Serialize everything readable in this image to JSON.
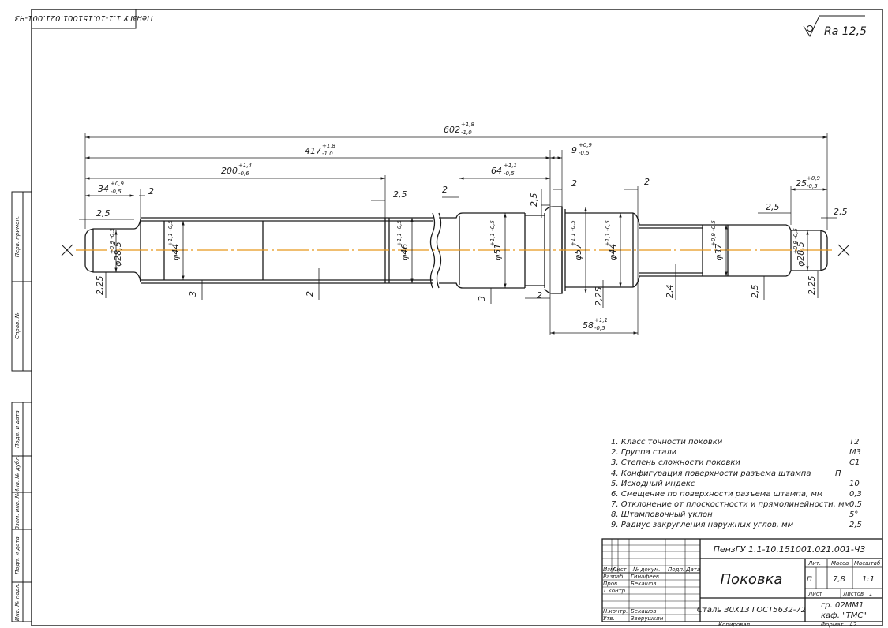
{
  "doc_code_rotated": "ПензГУ 1.1-10.151001.021.001-Ч3",
  "roughness": "Ra 12,5",
  "dimensions": {
    "overall": "602",
    "overall_tol_upper": "+1,8",
    "overall_tol_lower": "-1,0",
    "d417": "417",
    "d417_upper": "+1,8",
    "d417_lower": "-1,0",
    "d200": "200",
    "d200_upper": "+1,4",
    "d200_lower": "-0,6",
    "d34": "34",
    "d34_upper": "+0,9",
    "d34_lower": "-0,5",
    "d64": "64",
    "d64_upper": "+1,1",
    "d64_lower": "-0,5",
    "d9": "9",
    "d9_upper": "+0,9",
    "d9_lower": "-0,5",
    "d25": "25",
    "d25_upper": "+0,9",
    "d25_lower": "-0,5",
    "d58": "58",
    "d58_upper": "+1,1",
    "d58_lower": "-0,5",
    "two": "2",
    "two_five": "2,5",
    "three": "3",
    "two_two_five": "2,25",
    "two_four": "2,4",
    "dia_285": "φ28,5",
    "dia_285_tol": "+0,9 -0,5",
    "dia_44": "φ44",
    "dia_44_tol": "+1,1 -0,5",
    "dia_46": "φ46",
    "dia_46_tol": "+1,1 -0,5",
    "dia_51": "φ51",
    "dia_51_tol": "+1,1 -0,5",
    "dia_57": "φ57",
    "dia_57_tol": "+1,1 -0,5",
    "dia_37": "φ37",
    "dia_37_tol": "+0,9 -0,5"
  },
  "notes": [
    {
      "text": "1. Класс точности поковки",
      "value": "Т2"
    },
    {
      "text": "2. Группа стали",
      "value": "М3"
    },
    {
      "text": "3. Степень сложности поковки",
      "value": "С1"
    },
    {
      "text": "4. Конфигурация поверхности разъема штампа",
      "value": "П"
    },
    {
      "text": "5. Исходный индекс",
      "value": "10"
    },
    {
      "text": "6. Смещение по поверхности разъема штампа, мм",
      "value": "0,3"
    },
    {
      "text": "7. Отклонение от плоскостности и прямолинейности, мм",
      "value": "0,5"
    },
    {
      "text": "8. Штамповочный уклон",
      "value": "5°"
    },
    {
      "text": "9. Радиус закругления наружных углов, мм",
      "value": "2,5"
    }
  ],
  "title_block": {
    "doc_number": "ПензГУ 1.1-10.151001.021.001-Ч3",
    "part_name": "Поковка",
    "material": "Сталь 30Х13 ГОСТ5632-72",
    "col_izm": "Изм.",
    "col_list": "Лист",
    "col_doc": "№ докум.",
    "col_sign": "Подп.",
    "col_date": "Дата",
    "razrab_label": "Разраб.",
    "razrab_name": "Гинафеев",
    "prov_label": "Пров.",
    "prov_name": "Бекашов",
    "tkontr_label": "Т.контр.",
    "nkontr_label": "Н.контр.",
    "nkontr_name": "Бекашов",
    "utv_label": "Утв.",
    "utv_name": "Зверушкин",
    "lit_label": "Лит.",
    "mass_label": "Масса",
    "scale_label": "Масштаб",
    "lit_value": "П",
    "mass_value": "7,8",
    "scale_value": "1:1",
    "sheet_label": "Лист",
    "sheets_label": "Листов",
    "sheets_value": "1",
    "group": "гр. 02ММ1",
    "dept": "каф. \"ТМС\"",
    "copied": "Копировал",
    "format_label": "Формат",
    "format_value": "А2"
  },
  "side_stamp": {
    "perv_primen": "Перв. примен.",
    "sprav_no": "Справ. №",
    "podp_data_1": "Подп. и дата",
    "inv_dubl": "Инв. № дубл.",
    "vzam_inv": "Взам. инв. №",
    "podp_data_2": "Подп. и дата",
    "inv_podl": "Инв. № подл."
  },
  "colors": {
    "line": "#1a1a1a",
    "axis": "#e8961a",
    "paper": "#ffffff"
  }
}
